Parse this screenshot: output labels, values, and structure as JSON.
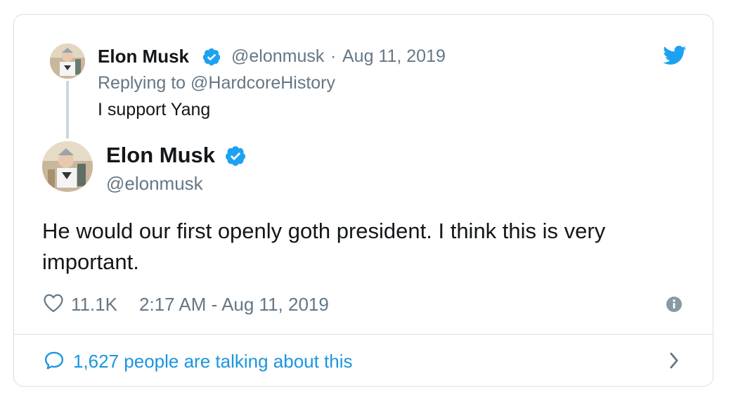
{
  "quoted": {
    "name": "Elon Musk",
    "handle": "@elonmusk",
    "sep": "·",
    "date": "Aug 11, 2019",
    "replying_to": "Replying to @HardcoreHistory",
    "text": "I support Yang"
  },
  "main": {
    "name": "Elon Musk",
    "handle": "@elonmusk",
    "text": "He would our first openly goth president. I think this is very important."
  },
  "meta": {
    "likes": "11.1K",
    "timestamp": "2:17 AM - Aug 11, 2019"
  },
  "footer": {
    "talking": "1,627 people are talking about this"
  },
  "icons": {
    "brand": "twitter-bird",
    "verified": "verified-badge",
    "like": "heart-outline",
    "info": "info",
    "reply": "speech-bubble",
    "chevron": "chevron-right"
  },
  "colors": {
    "accent": "#1da1f2",
    "link": "#1b95e0",
    "muted": "#657786",
    "text": "#14171a",
    "border": "#d8dee3"
  }
}
